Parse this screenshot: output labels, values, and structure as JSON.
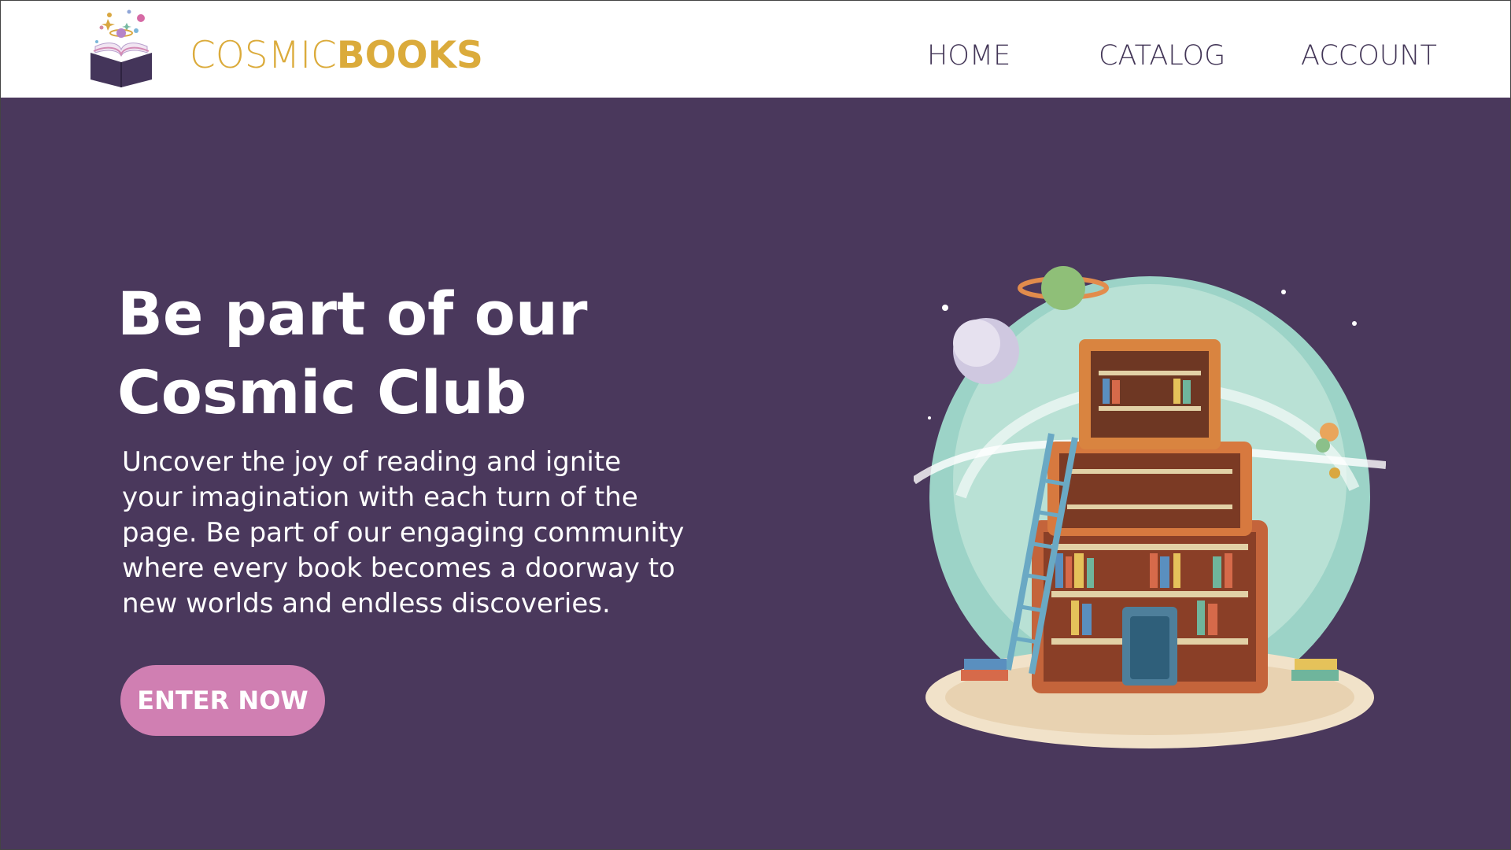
{
  "brand": {
    "part1": "COSMIC",
    "part2": "BOOKS"
  },
  "nav": [
    {
      "label": "HOME"
    },
    {
      "label": "CATALOG"
    },
    {
      "label": "ACCOUNT"
    }
  ],
  "hero": {
    "title_line1": "Be part of our",
    "title_line2": "Cosmic Club",
    "text": "Uncover the joy of reading and ignite your imagination with each turn of the page. Be part of our engaging community where every book becomes a doorway to new worlds and endless discoveries.",
    "cta_label": "ENTER NOW"
  },
  "colors": {
    "background": "#4a385c",
    "brand": "#dbab3b",
    "nav_text": "#433657",
    "cta": "#d07fb2"
  },
  "icons": [
    "open-book-logo-icon"
  ]
}
